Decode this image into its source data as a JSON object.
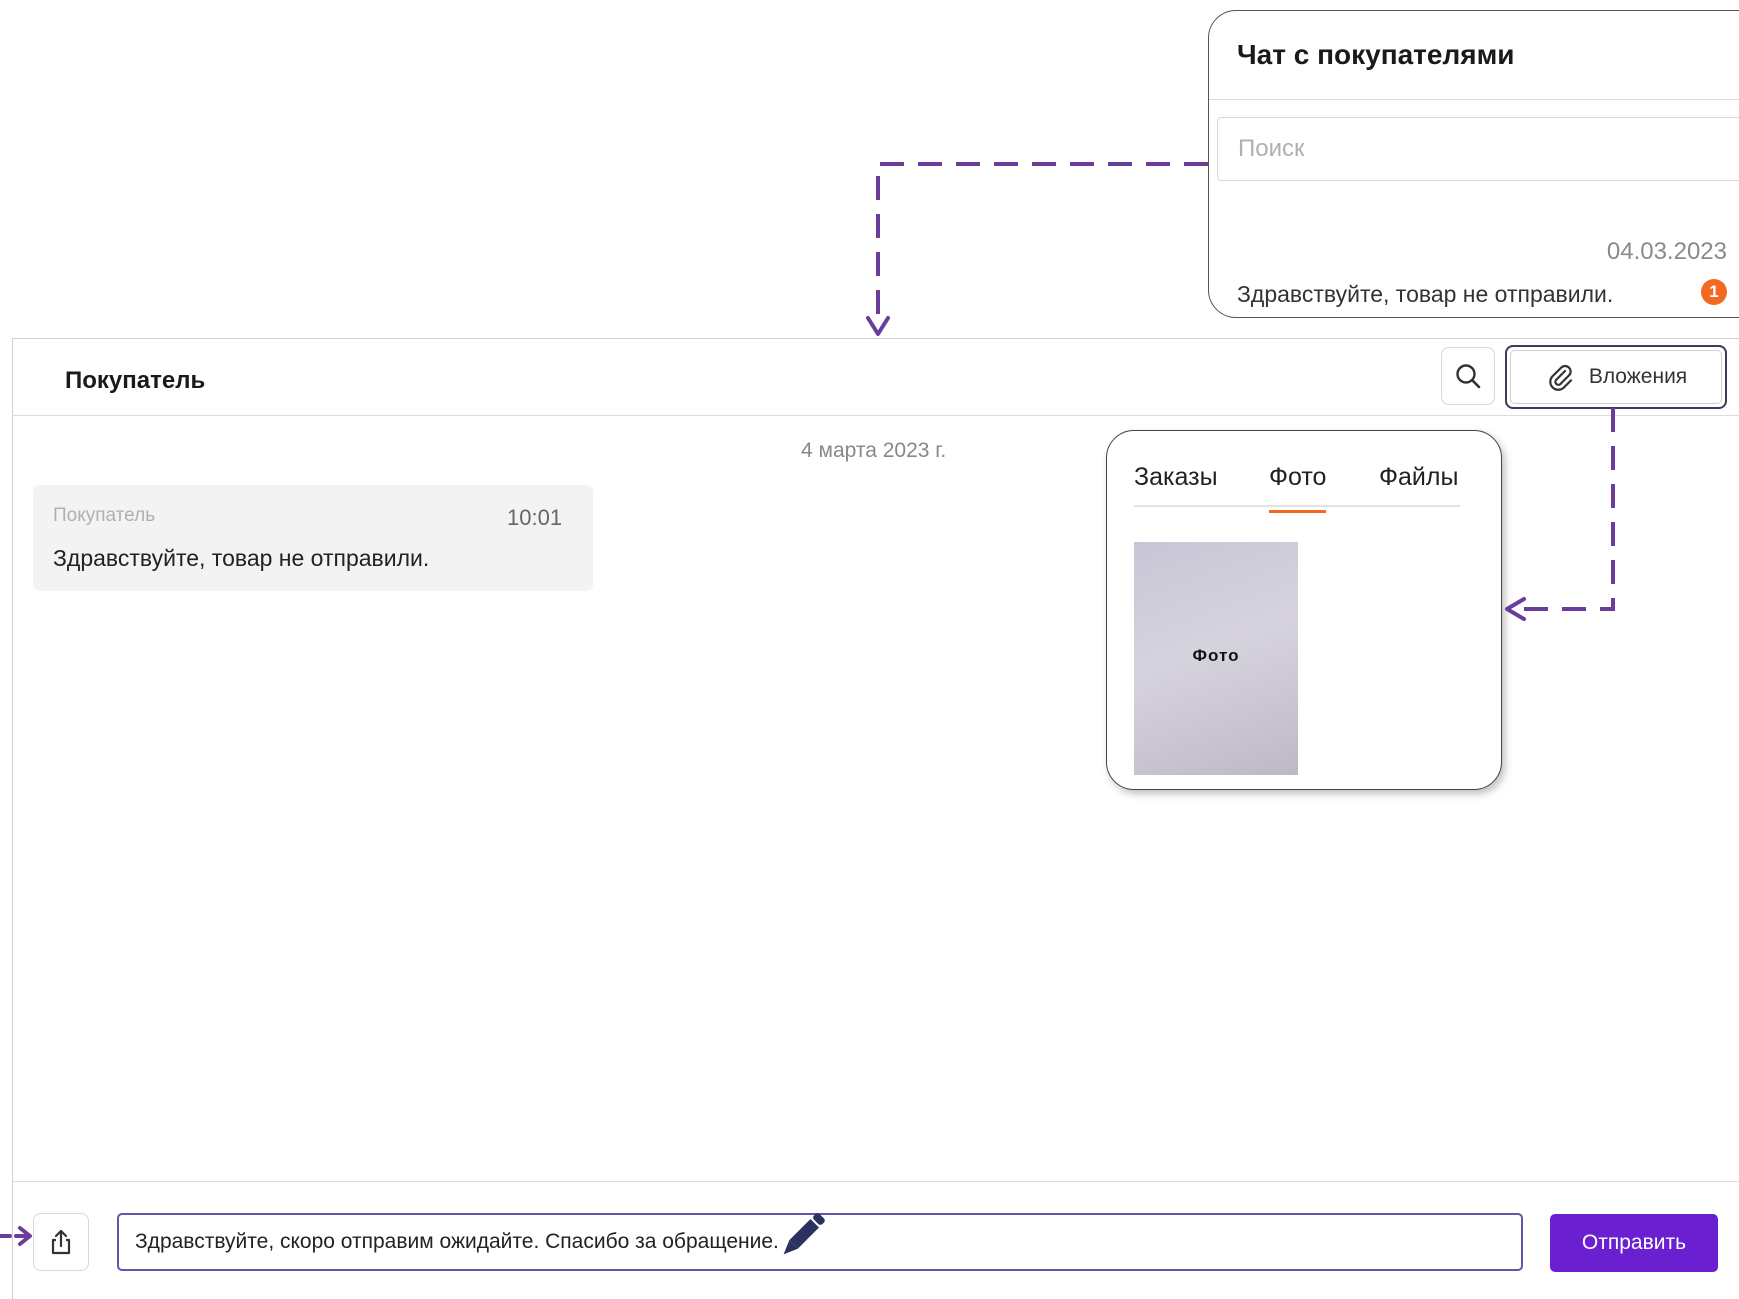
{
  "chat_list": {
    "title": "Чат с покупателями",
    "search_placeholder": "Поиск",
    "items": [
      {
        "date": "04.03.2023",
        "preview": "Здравствуйте, товар не отправили.",
        "unread": "1"
      }
    ]
  },
  "chat": {
    "title": "Покупатель",
    "attachments_label": "Вложения",
    "date_separator": "4 марта 2023 г.",
    "messages": [
      {
        "sender": "Покупатель",
        "time": "10:01",
        "text": "Здравствуйте, товар не отправили."
      }
    ]
  },
  "attachments_popup": {
    "tabs": [
      {
        "label": "Заказы"
      },
      {
        "label": "Фото"
      },
      {
        "label": "Файлы"
      }
    ],
    "active_tab": "Фото",
    "photo_label": "Фото"
  },
  "composer": {
    "value": "Здравствуйте, скоро отправим ожидайте. Спасибо за обращение.",
    "send_label": "Отправить"
  },
  "colors": {
    "accent": "#6a1fd1",
    "annotation": "#6a3d9a",
    "badge": "#f26a22"
  },
  "icons": [
    "search-icon",
    "paperclip-icon",
    "upload-icon",
    "pencil-icon"
  ]
}
